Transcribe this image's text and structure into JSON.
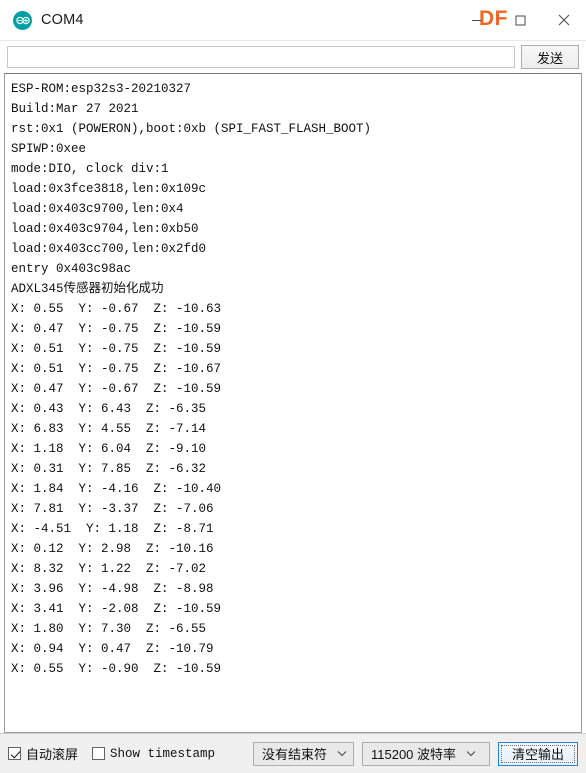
{
  "window": {
    "title": "COM4",
    "app_icon": "arduino-infinity-icon",
    "watermark": "DF",
    "watermark_color": "#F26522",
    "controls": {
      "minimize": "minimize-icon",
      "maximize": "maximize-icon",
      "close": "close-icon"
    }
  },
  "send_bar": {
    "input_value": "",
    "input_placeholder": "",
    "send_label": "发送"
  },
  "console": {
    "lines": [
      "ESP-ROM:esp32s3-20210327",
      "Build:Mar 27 2021",
      "rst:0x1 (POWERON),boot:0xb (SPI_FAST_FLASH_BOOT)",
      "SPIWP:0xee",
      "mode:DIO, clock div:1",
      "load:0x3fce3818,len:0x109c",
      "load:0x403c9700,len:0x4",
      "load:0x403c9704,len:0xb50",
      "load:0x403cc700,len:0x2fd0",
      "entry 0x403c98ac",
      "ADXL345传感器初始化成功",
      "X: 0.55  Y: -0.67  Z: -10.63",
      "X: 0.47  Y: -0.75  Z: -10.59",
      "X: 0.51  Y: -0.75  Z: -10.59",
      "X: 0.51  Y: -0.75  Z: -10.67",
      "X: 0.47  Y: -0.67  Z: -10.59",
      "X: 0.43  Y: 6.43  Z: -6.35",
      "X: 6.83  Y: 4.55  Z: -7.14",
      "X: 1.18  Y: 6.04  Z: -9.10",
      "X: 0.31  Y: 7.85  Z: -6.32",
      "X: 1.84  Y: -4.16  Z: -10.40",
      "X: 7.81  Y: -3.37  Z: -7.06",
      "X: -4.51  Y: 1.18  Z: -8.71",
      "X: 0.12  Y: 2.98  Z: -10.16",
      "X: 8.32  Y: 1.22  Z: -7.02",
      "X: 3.96  Y: -4.98  Z: -8.98",
      "X: 3.41  Y: -2.08  Z: -10.59",
      "X: 1.80  Y: 7.30  Z: -6.55",
      "X: 0.94  Y: 0.47  Z: -10.79",
      "X: 0.55  Y: -0.90  Z: -10.59"
    ]
  },
  "status_bar": {
    "autoscroll_label": "自动滚屏",
    "autoscroll_checked": true,
    "timestamp_label": "Show timestamp",
    "timestamp_checked": false,
    "line_ending_value": "没有结束符",
    "baud_value": "115200 波特率",
    "clear_label": "清空输出",
    "focus_color": "#2a7fd4"
  }
}
